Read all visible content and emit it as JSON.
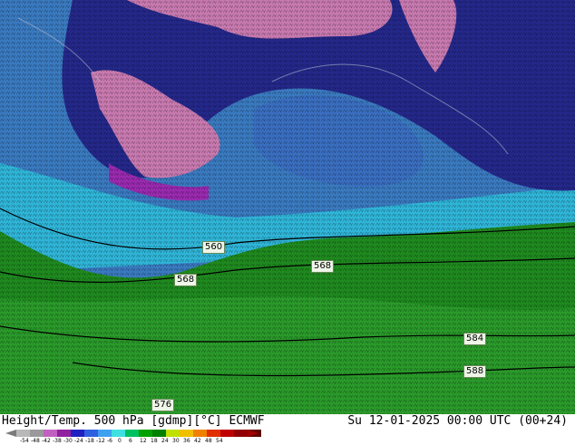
{
  "caption": "Height/Temp. 500 hPa [gdmp][°C] ECMWF",
  "datetime": "Su 12-01-2025 00:00 UTC (00+24)",
  "contour_labels": [
    "560",
    "568",
    "568",
    "576",
    "584",
    "588"
  ],
  "colorbar": {
    "ticks": [
      "-54",
      "-48",
      "-42",
      "-38",
      "-30",
      "-24",
      "-18",
      "-12",
      "-6",
      "0",
      "6",
      "12",
      "18",
      "24",
      "30",
      "36",
      "42",
      "48",
      "54"
    ],
    "colors": [
      "#b8b8b8",
      "#9a9a9a",
      "#c060c0",
      "#9020a0",
      "#2020c0",
      "#3060e0",
      "#40a0f0",
      "#40e0e0",
      "#00c060",
      "#00a000",
      "#008000",
      "#c0e000",
      "#f0c000",
      "#f08000",
      "#e03000",
      "#c00000",
      "#900000",
      "#600000"
    ]
  }
}
